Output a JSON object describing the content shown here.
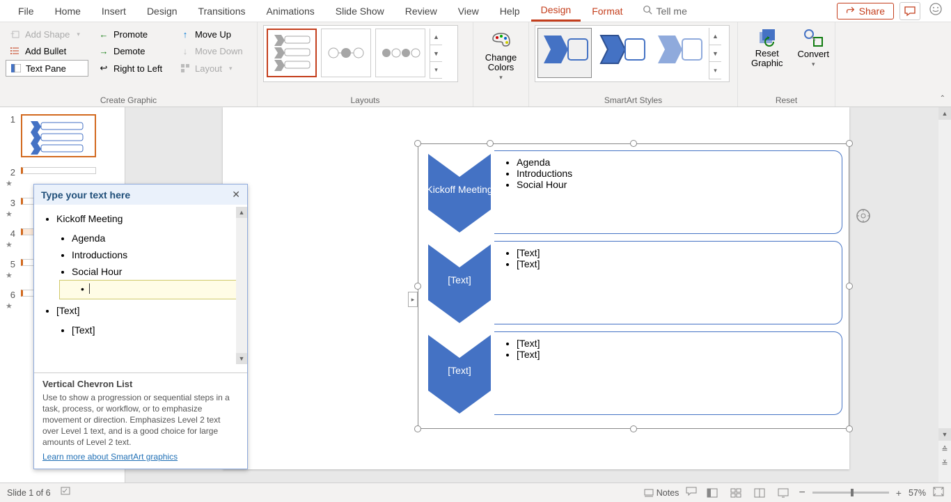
{
  "menu": {
    "tabs": [
      "File",
      "Home",
      "Insert",
      "Design",
      "Transitions",
      "Animations",
      "Slide Show",
      "Review",
      "View",
      "Help",
      "Design",
      "Format"
    ],
    "active_index": 10,
    "tellme": "Tell me",
    "share": "Share"
  },
  "ribbon": {
    "create": {
      "label": "Create Graphic",
      "add_shape": "Add Shape",
      "add_bullet": "Add Bullet",
      "text_pane": "Text Pane",
      "promote": "Promote",
      "demote": "Demote",
      "rtl": "Right to Left",
      "move_up": "Move Up",
      "move_down": "Move Down",
      "layout": "Layout"
    },
    "layouts_label": "Layouts",
    "change_colors": "Change Colors",
    "styles_label": "SmartArt Styles",
    "reset": {
      "label": "Reset",
      "reset_graphic": "Reset Graphic",
      "convert": "Convert"
    }
  },
  "slides": {
    "count": 6
  },
  "smartart": {
    "rows": [
      {
        "title": "Kickoff Meeting",
        "bullets": [
          "Agenda",
          "Introductions",
          "Social Hour"
        ]
      },
      {
        "title": "[Text]",
        "bullets": [
          "[Text]",
          "[Text]"
        ]
      },
      {
        "title": "[Text]",
        "bullets": [
          "[Text]",
          "[Text]"
        ]
      }
    ]
  },
  "textpane": {
    "title": "Type your text here",
    "items_l1": [
      "Kickoff Meeting",
      "[Text]"
    ],
    "items_l2_a": [
      "Agenda",
      "Introductions",
      "Social Hour"
    ],
    "items_l2_b": [
      "[Text]"
    ],
    "footer_title": "Vertical Chevron List",
    "footer_desc": "Use to show a progression or sequential steps in a task, process, or workflow, or to emphasize movement or direction. Emphasizes Level 2 text over Level 1 text, and is a good choice for large amounts of Level 2 text.",
    "footer_link": "Learn more about SmartArt graphics"
  },
  "status": {
    "slide": "Slide 1 of 6",
    "notes": "Notes",
    "zoom": "57%"
  },
  "colors": {
    "accent": "#4472c4",
    "brand": "#c43e1c"
  }
}
